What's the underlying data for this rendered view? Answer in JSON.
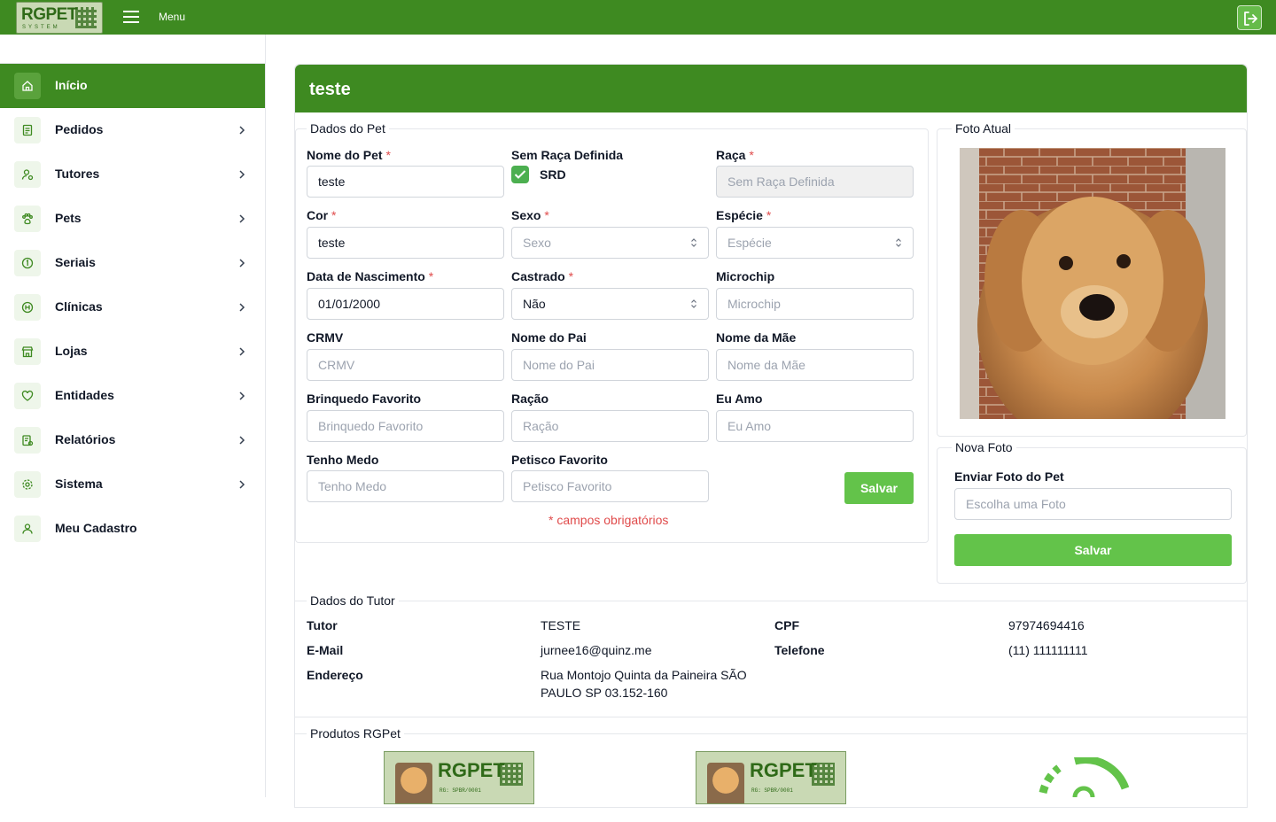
{
  "topbar": {
    "logo_text": "RGPET",
    "logo_sub": "SYSTEM",
    "menu_label": "Menu"
  },
  "sidebar": {
    "items": [
      {
        "label": "Início",
        "icon": "home-icon",
        "active": true
      },
      {
        "label": "Pedidos",
        "icon": "document-icon"
      },
      {
        "label": "Tutores",
        "icon": "user-icon"
      },
      {
        "label": "Pets",
        "icon": "paw-icon"
      },
      {
        "label": "Seriais",
        "icon": "serial-icon"
      },
      {
        "label": "Clínicas",
        "icon": "hospital-icon"
      },
      {
        "label": "Lojas",
        "icon": "store-icon"
      },
      {
        "label": "Entidades",
        "icon": "heart-icon"
      },
      {
        "label": "Relatórios",
        "icon": "report-icon"
      },
      {
        "label": "Sistema",
        "icon": "gear-icon"
      },
      {
        "label": "Meu Cadastro",
        "icon": "profile-icon"
      }
    ]
  },
  "card": {
    "title": "teste"
  },
  "pet": {
    "legend": "Dados do Pet",
    "nome_label": "Nome do Pet",
    "nome_value": "teste",
    "srd_label": "Sem Raça Definida",
    "srd_check_label": "SRD",
    "raca_label": "Raça",
    "raca_value": "Sem Raça Definida",
    "cor_label": "Cor",
    "cor_value": "teste",
    "sexo_label": "Sexo",
    "sexo_placeholder": "Sexo",
    "especie_label": "Espécie",
    "especie_placeholder": "Espécie",
    "nasc_label": "Data de Nascimento",
    "nasc_value": "01/01/2000",
    "castrado_label": "Castrado",
    "castrado_value": "Não",
    "microchip_label": "Microchip",
    "microchip_placeholder": "Microchip",
    "crmv_label": "CRMV",
    "crmv_placeholder": "CRMV",
    "pai_label": "Nome do Pai",
    "pai_placeholder": "Nome do Pai",
    "mae_label": "Nome da Mãe",
    "mae_placeholder": "Nome da Mãe",
    "brinquedo_label": "Brinquedo Favorito",
    "brinquedo_placeholder": "Brinquedo Favorito",
    "racao_label": "Ração",
    "racao_placeholder": "Ração",
    "euamo_label": "Eu Amo",
    "euamo_placeholder": "Eu Amo",
    "medo_label": "Tenho Medo",
    "medo_placeholder": "Tenho Medo",
    "petisco_label": "Petisco Favorito",
    "petisco_placeholder": "Petisco Favorito",
    "save_label": "Salvar",
    "required_note": "* campos obrigatórios",
    "req_mark": "*"
  },
  "foto": {
    "legend": "Foto Atual"
  },
  "nova_foto": {
    "legend": "Nova Foto",
    "label": "Enviar Foto do Pet",
    "placeholder": "Escolha uma Foto",
    "save_label": "Salvar"
  },
  "tutor": {
    "legend": "Dados do Tutor",
    "tutor_label": "Tutor",
    "tutor_value": "TESTE",
    "cpf_label": "CPF",
    "cpf_value": "97974694416",
    "email_label": "E-Mail",
    "email_value": "jurnee16@quinz.me",
    "telefone_label": "Telefone",
    "telefone_value": "(11) 111111111",
    "endereco_label": "Endereço",
    "endereco_line1": "Rua Montojo Quinta da Paineira SÃO",
    "endereco_line2": "PAULO SP 03.152-160"
  },
  "produtos": {
    "legend": "Produtos RGPet",
    "card_text": "RGPET",
    "card_rg": "RG: SPBR/0001"
  },
  "colors": {
    "primary": "#3e8a21",
    "button": "#63c34a",
    "required": "#e04b4b"
  }
}
